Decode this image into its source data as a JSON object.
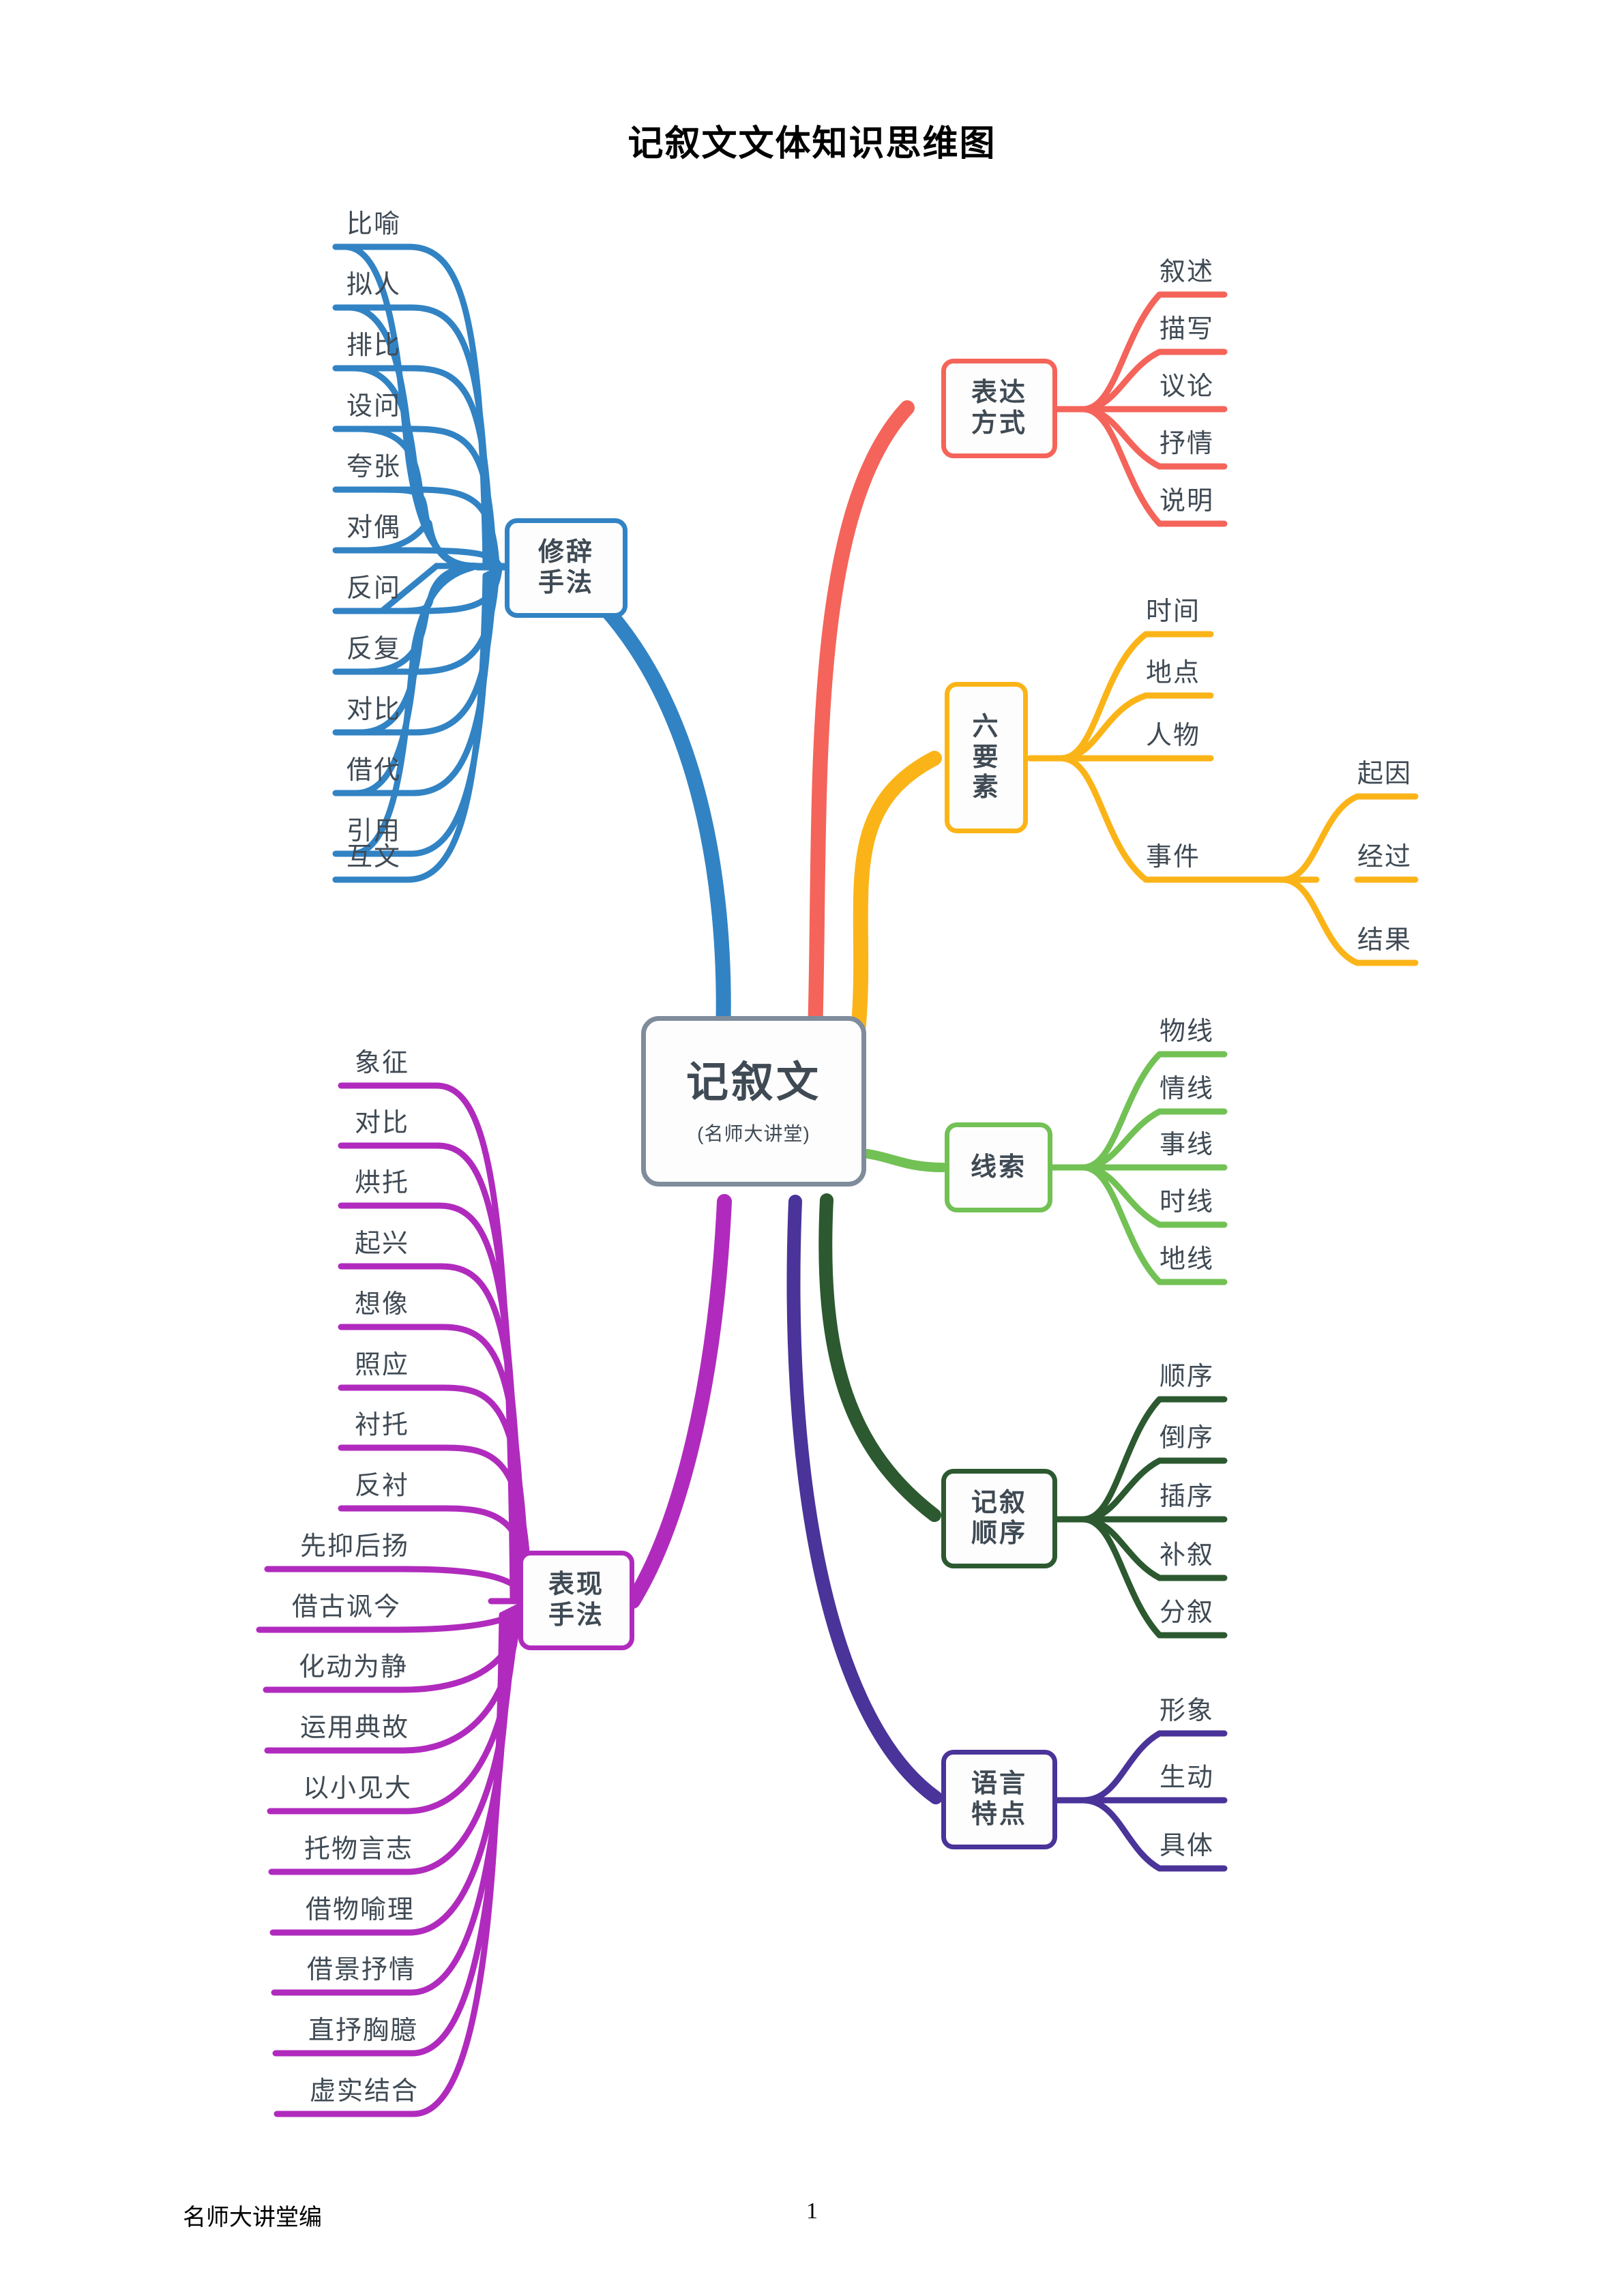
{
  "page": {
    "title": "记叙文文体知识思维图",
    "footer_note": "名师大讲堂编",
    "page_number": "1"
  },
  "center": {
    "label": "记叙文",
    "sublabel": "(名师大讲堂)",
    "color": "#7f8c9b"
  },
  "branches": [
    {
      "id": "xiucishoufa",
      "label": "修辞\n手法",
      "label_line1": "修辞",
      "label_line2": "手法",
      "color": "#3183c4",
      "side": "left",
      "leaves": [
        "比喻",
        "拟人",
        "排比",
        "设问",
        "夸张",
        "对偶",
        "反问",
        "反复",
        "对比",
        "借代",
        "引用",
        "互文"
      ]
    },
    {
      "id": "biaodafangshi",
      "label": "表达\n方式",
      "label_line1": "表达",
      "label_line2": "方式",
      "color": "#f4645a",
      "side": "right",
      "leaves": [
        "叙述",
        "描写",
        "议论",
        "抒情",
        "说明"
      ]
    },
    {
      "id": "liuyaosu",
      "label": "六要素",
      "label_line1": "六",
      "label_line2": "要",
      "label_line3": "素",
      "color": "#fbb418",
      "side": "right",
      "leaves": [
        "时间",
        "地点",
        "人物",
        "事件"
      ],
      "sub": {
        "parent": "事件",
        "leaves": [
          "起因",
          "经过",
          "结果"
        ]
      }
    },
    {
      "id": "xiansuo",
      "label": "线索",
      "label_line1": "线索",
      "color": "#72c154",
      "side": "right",
      "leaves": [
        "物线",
        "情线",
        "事线",
        "时线",
        "地线"
      ]
    },
    {
      "id": "jixushunxu",
      "label": "记叙\n顺序",
      "label_line1": "记叙",
      "label_line2": "顺序",
      "color": "#2c5930",
      "side": "right",
      "leaves": [
        "顺序",
        "倒序",
        "插序",
        "补叙",
        "分叙"
      ]
    },
    {
      "id": "yuyantedian",
      "label": "语言\n特点",
      "label_line1": "语言",
      "label_line2": "特点",
      "color": "#4a3399",
      "side": "right",
      "leaves": [
        "形象",
        "生动",
        "具体"
      ]
    },
    {
      "id": "biaoxianshoufa",
      "label": "表现\n手法",
      "label_line1": "表现",
      "label_line2": "手法",
      "color": "#b02bbd",
      "side": "left",
      "leaves": [
        "象征",
        "对比",
        "烘托",
        "起兴",
        "想像",
        "照应",
        "衬托",
        "反衬",
        "先抑后扬",
        "借古讽今",
        "化动为静",
        "运用典故",
        "以小见大",
        "托物言志",
        "借物喻理",
        "借景抒情",
        "直抒胸臆",
        "虚实结合"
      ]
    }
  ]
}
